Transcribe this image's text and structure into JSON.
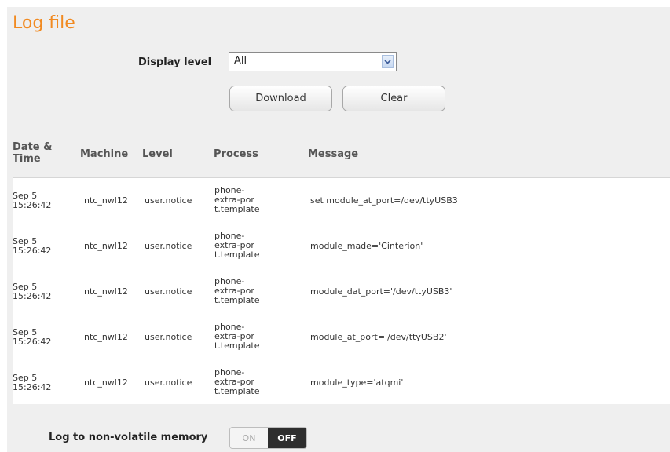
{
  "page": {
    "title": "Log file"
  },
  "filter": {
    "display_level_label": "Display level",
    "display_level_value": "All"
  },
  "actions": {
    "download_label": "Download",
    "clear_label": "Clear"
  },
  "table": {
    "headers": {
      "date": [
        "Date &",
        "Time"
      ],
      "machine": "Machine",
      "level": "Level",
      "process": "Process",
      "message": "Message"
    },
    "rows": [
      {
        "date": [
          "Sep 5",
          "15:26:42"
        ],
        "machine": "ntc_nwl12",
        "level": "user.notice",
        "process": [
          "phone-",
          "extra-por",
          "t.template"
        ],
        "message": "set module_at_port=/dev/ttyUSB3"
      },
      {
        "date": [
          "Sep 5",
          "15:26:42"
        ],
        "machine": "ntc_nwl12",
        "level": "user.notice",
        "process": [
          "phone-",
          "extra-por",
          "t.template"
        ],
        "message": "module_made='Cinterion'"
      },
      {
        "date": [
          "Sep 5",
          "15:26:42"
        ],
        "machine": "ntc_nwl12",
        "level": "user.notice",
        "process": [
          "phone-",
          "extra-por",
          "t.template"
        ],
        "message": "module_dat_port='/dev/ttyUSB3'"
      },
      {
        "date": [
          "Sep 5",
          "15:26:42"
        ],
        "machine": "ntc_nwl12",
        "level": "user.notice",
        "process": [
          "phone-",
          "extra-por",
          "t.template"
        ],
        "message": "module_at_port='/dev/ttyUSB2'"
      },
      {
        "date": [
          "Sep 5",
          "15:26:42"
        ],
        "machine": "ntc_nwl12",
        "level": "user.notice",
        "process": [
          "phone-",
          "extra-por",
          "t.template"
        ],
        "message": "module_type='atqmi'"
      }
    ]
  },
  "non_volatile": {
    "label": "Log to non-volatile memory",
    "on_label": "ON",
    "off_label": "OFF"
  },
  "colors": {
    "title": "#f18a21",
    "toggle_off": "#2e2e2e"
  }
}
